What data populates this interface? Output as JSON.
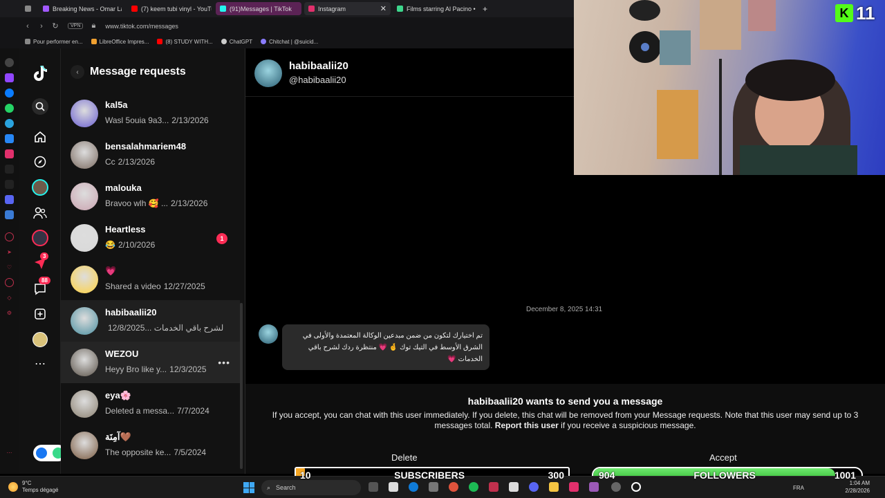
{
  "browser": {
    "tabs": [
      {
        "label": "",
        "icon": "grid-icon",
        "color": "#888888"
      },
      {
        "label": "Breaking News - Omar Lay",
        "icon": "heart-icon",
        "color": "#a259ff"
      },
      {
        "label": "(7) keem tubi vinyl - YouTu",
        "icon": "youtube-icon",
        "color": "#ff0000"
      },
      {
        "label": "(91)Messages | TikTok",
        "icon": "tiktok-icon",
        "color": "#25f4ee"
      },
      {
        "label": "Instagram",
        "icon": "instagram-icon",
        "color": "#e1306c"
      },
      {
        "label": "Films starring Al Pacino •",
        "icon": "globe-icon",
        "color": "#3dd68c"
      }
    ],
    "new_tab": "+",
    "url": "www.tiktok.com/messages",
    "vpn_label": "VPN",
    "bookmarks": [
      {
        "label": "Pour performer en...",
        "color": "#888888"
      },
      {
        "label": "LibreOffice Impres...",
        "color": "#f0a030"
      },
      {
        "label": "(8) STUDY WITH...",
        "color": "#ff0000"
      },
      {
        "label": "ChatGPT",
        "color": "#cccccc"
      },
      {
        "label": "Chitchat | @suicid...",
        "color": "#8a7cff"
      }
    ]
  },
  "tiktok_nav": {
    "badges": {
      "activity": "3",
      "messages": "88"
    }
  },
  "requests": {
    "title": "Message requests",
    "items": [
      {
        "name": "kal5a",
        "preview": "Wasl 5ouia 9a3...",
        "date": "2/13/2026",
        "avatar_color": "#6a5fd1",
        "badge": ""
      },
      {
        "name": "bensalahmariem48",
        "preview": "Cc",
        "date": "2/13/2026",
        "avatar_color": "#7a6a60",
        "badge": ""
      },
      {
        "name": "malouka",
        "preview": "Bravoo wlh 🥰 ...",
        "date": "2/13/2026",
        "avatar_color": "#caa3b0",
        "badge": ""
      },
      {
        "name": "Heartless",
        "preview": "😂",
        "date": "2/10/2026",
        "avatar_color": "#d9d9d9",
        "badge": "1"
      },
      {
        "name": "💗",
        "preview": "Shared a video",
        "date": "12/27/2025",
        "avatar_color": "#ffd23f",
        "badge": ""
      },
      {
        "name": "habibaalii20",
        "preview": "لشرح باقي الخدمات ...",
        "date": "12/8/2025",
        "avatar_color": "#4a8fa0",
        "badge": ""
      },
      {
        "name": "WEZOU",
        "preview": "Heyy Bro like y...",
        "date": "12/3/2025",
        "avatar_color": "#5a5248",
        "badge": ""
      },
      {
        "name": "eya🌸",
        "preview": "Deleted a messa...",
        "date": "7/7/2024",
        "avatar_color": "#8a8070",
        "badge": ""
      },
      {
        "name": "آمِنَة🤎",
        "preview": "The opposite ke...",
        "date": "7/5/2024",
        "avatar_color": "#7a5a40",
        "badge": ""
      }
    ]
  },
  "chat": {
    "name": "habibaalii20",
    "handle": "@habibaalii20",
    "date": "December 8, 2025 14:31",
    "message": "تم اختيارك لتكون من ضمن مبدعين الوكالة المعتمدة والأولى في الشرق الأوسط في التيك توك 🤞 💗 منتظرة ردك لشرح باقي الخدمات 💗",
    "request_title": "habibaalii20 wants to send you a message",
    "request_text_1": "If you accept, you can chat with this user immediately. If you delete, this chat will be removed from your Message requests. Note that this user may send up to 3 messages total.",
    "report_label": "Report this user",
    "request_text_2": "if you receive a suspicious message.",
    "delete_label": "Delete",
    "accept_label": "Accept",
    "peek_letters": [
      "c",
      "je",
      "b"
    ]
  },
  "overlay": {
    "kick_logo": "K",
    "kick_count": "11",
    "subs_left": "10",
    "subs_label": "SUBSCRIBERS",
    "subs_right": "300",
    "subs_progress": 0.033,
    "followers_left": "904",
    "followers_label": "FOLLOWERS",
    "followers_right": "1001",
    "followers_progress": 0.903
  },
  "taskbar": {
    "temperature": "9°C",
    "weather": "Temps dégagé",
    "search_placeholder": "Search",
    "language": "FRA",
    "time": "1:04 AM",
    "date": "2/28/2026"
  }
}
